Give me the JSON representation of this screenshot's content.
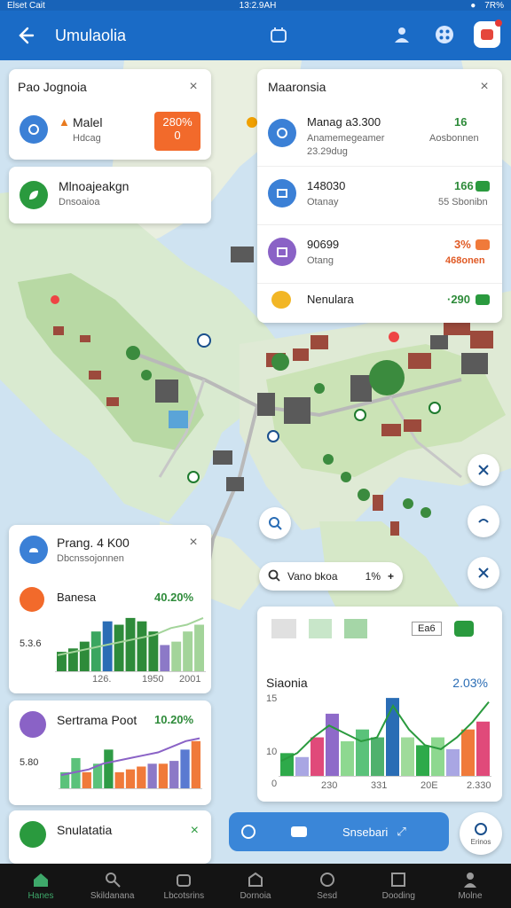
{
  "status_bar": {
    "left": "Elset Cait",
    "time": "13:2.9AH",
    "right": "7R%"
  },
  "app_bar": {
    "title": "Umulaolia"
  },
  "card1": {
    "title": "Pao Jognoia",
    "item1_label": "Malel",
    "item1_sub": "Hdcag",
    "item1_badge": "280%",
    "item1_badge2": "0"
  },
  "card2": {
    "title": "Mlnoajeakgn",
    "sub": "Dnsoaioa"
  },
  "card3": {
    "title": "Maaronsia",
    "rows": [
      {
        "label": "Manag a3.300",
        "sub": "Anamemegeamer",
        "sub2": "23.29dug",
        "value": "16",
        "value2": "Aosbonnen"
      },
      {
        "label": "148030",
        "sub": "Otanay",
        "value": "166",
        "value2": "55 Sbonibn"
      },
      {
        "label": "90699",
        "sub": "Otang",
        "value": "3%",
        "value2": "468onen"
      },
      {
        "label": "Nenulara",
        "value": "·290"
      }
    ]
  },
  "card_bottom1": {
    "title": "Prang. 4 K00",
    "sub": "Dbcnssojonnen",
    "metric_label": "Banesa",
    "metric_value": "40.20%",
    "ytick": "5.3.6",
    "xticks": [
      "126.",
      "1950",
      "2001"
    ]
  },
  "card_bottom2": {
    "title": "Sertrama Poot",
    "value": "10.20%",
    "ytick": "5.80"
  },
  "card_bottom3": {
    "title": "Snulatatia"
  },
  "card_big": {
    "title": "Siaonia",
    "value": "2.03%",
    "yticks": [
      "15",
      "10",
      "0"
    ],
    "xticks": [
      "0",
      "230",
      "331",
      "20E",
      "2.330"
    ],
    "tool_label": "Ea6"
  },
  "search": {
    "label": "Vano bkoa",
    "value": "1%"
  },
  "action_bar": {
    "label": "Snsebari"
  },
  "fab_label": "Erinos",
  "nav": [
    {
      "label": "Hanes"
    },
    {
      "label": "Skildanana"
    },
    {
      "label": "Lbcotsrins"
    },
    {
      "label": "Dornoia"
    },
    {
      "label": "Sesd"
    },
    {
      "label": "Dooding"
    },
    {
      "label": "Molne"
    }
  ],
  "chart_data": [
    {
      "type": "bar",
      "values": [
        6,
        7,
        9,
        12,
        15,
        14,
        16,
        15,
        12,
        8,
        9,
        12,
        14
      ],
      "colors": [
        "#2e8b3a",
        "#2e8b3a",
        "#2e8b3a",
        "#3aa660",
        "#2a6db5",
        "#2e8b3a",
        "#2e8b3a",
        "#2e8b3a",
        "#2e8b3a",
        "#8c79c7",
        "#a3d49a",
        "#a3d49a",
        "#a3d49a"
      ],
      "line": [
        5,
        6,
        7,
        8,
        9,
        10,
        11,
        13,
        14,
        16
      ]
    },
    {
      "type": "bar",
      "values": [
        6,
        11,
        6,
        9,
        14,
        6,
        7,
        8,
        9,
        9,
        10,
        14,
        17
      ],
      "colors": [
        "#5bc27a",
        "#5bc27a",
        "#f07a3a",
        "#5bc27a",
        "#2e9b45",
        "#f07a3a",
        "#f07a3a",
        "#f07a3a",
        "#8c79c7",
        "#f07a3a",
        "#8c79c7",
        "#5a7ad1",
        "#f07a3a"
      ],
      "line": [
        5,
        6,
        7,
        9,
        10,
        11,
        12,
        13,
        15,
        17,
        18
      ]
    },
    {
      "type": "bar",
      "values": [
        3,
        2.5,
        5,
        8,
        4.5,
        6,
        5,
        10,
        5,
        4,
        5,
        3.5,
        6,
        7
      ],
      "colors": [
        "#2eaa4a",
        "#a9a6e3",
        "#e04a7a",
        "#8e6ac9",
        "#8ed890",
        "#5ac27a",
        "#4fb16d",
        "#2a6db5",
        "#9fdb9a",
        "#2eaa4a",
        "#8ed890",
        "#a9a6e3",
        "#f07a3a",
        "#e04a7a"
      ],
      "line": [
        2,
        3,
        5,
        6.5,
        5.5,
        4.5,
        5,
        9,
        6,
        4,
        3.5,
        5,
        7,
        9.5
      ]
    }
  ]
}
